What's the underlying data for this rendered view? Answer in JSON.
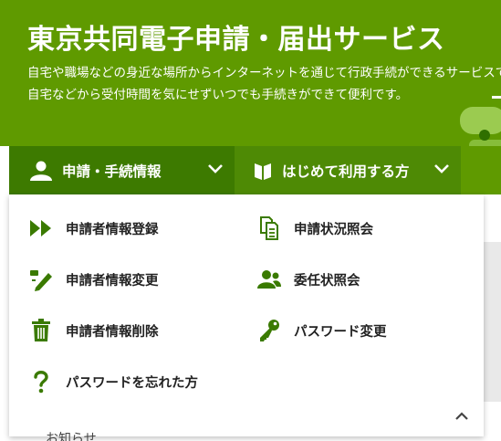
{
  "header": {
    "title": "東京共同電子申請・届出サービス",
    "description_line1": "自宅や職場などの身近な場所からインターネットを通じて行政手続ができるサービスで",
    "description_line2": "自宅などから受付時間を気にせずいつでも手続きができて便利です。"
  },
  "nav": {
    "tabs": [
      {
        "label": "申請・手続情報",
        "icon": "user-icon"
      },
      {
        "label": "はじめて利用する方",
        "icon": "book-icon"
      }
    ]
  },
  "menu": {
    "items": [
      {
        "label": "申請者情報登録",
        "icon": "fast-forward-icon"
      },
      {
        "label": "申請状況照会",
        "icon": "documents-icon"
      },
      {
        "label": "申請者情報変更",
        "icon": "edit-pencil-icon"
      },
      {
        "label": "委任状照会",
        "icon": "users-icon"
      },
      {
        "label": "申請者情報削除",
        "icon": "trash-icon"
      },
      {
        "label": "パスワード変更",
        "icon": "key-icon"
      },
      {
        "label": "パスワードを忘れた方",
        "icon": "question-icon"
      }
    ]
  },
  "below": {
    "partial_text": "お知らせ"
  },
  "colors": {
    "header_green": "#5f9a00",
    "tab_active": "#3d7a00",
    "tab_inactive": "#4e8a05",
    "icon_green": "#3a7a00"
  }
}
